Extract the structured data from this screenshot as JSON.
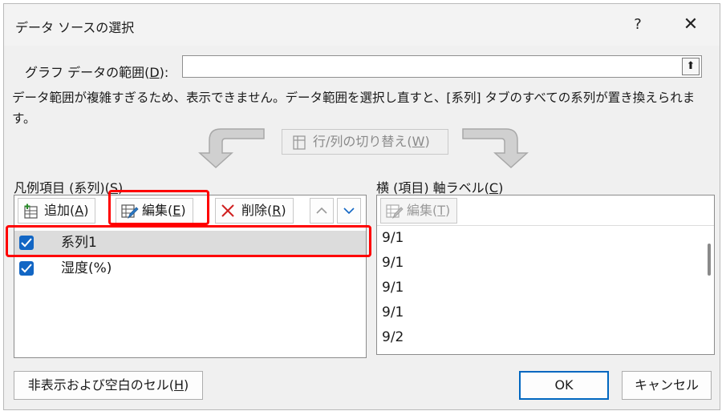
{
  "dialog": {
    "title": "データ ソースの選択",
    "help": "?",
    "close": "✕"
  },
  "range": {
    "label_prefix": "グラフ データの範囲(",
    "label_key": "D",
    "label_suffix": "):",
    "value": "",
    "collapse_icon": "⬆"
  },
  "warning": "データ範囲が複雑すぎるため、表示できません。データ範囲を選択し直すと、[系列] タブのすべての系列が置き換えられます。",
  "switch_button": {
    "prefix": "行/列の切り替え(",
    "key": "W",
    "suffix": ")"
  },
  "legend_section": {
    "label_prefix": "凡例項目 (系列)(",
    "label_key": "S",
    "label_suffix": ")",
    "add": {
      "prefix": "追加(",
      "key": "A",
      "suffix": ")"
    },
    "edit": {
      "prefix": "編集(",
      "key": "E",
      "suffix": ")"
    },
    "remove": {
      "prefix": "削除(",
      "key": "R",
      "suffix": ")"
    },
    "series": [
      {
        "label": "系列1",
        "checked": true
      },
      {
        "label": "湿度(%)",
        "checked": true
      }
    ]
  },
  "axis_section": {
    "label_prefix": "横 (項目) 軸ラベル(",
    "label_key": "C",
    "label_suffix": ")",
    "edit": {
      "prefix": "編集(",
      "key": "T",
      "suffix": ")"
    },
    "items": [
      "9/1",
      "9/1",
      "9/1",
      "9/1",
      "9/2"
    ]
  },
  "buttons": {
    "hidden_cells": {
      "prefix": "非表示および空白のセル(",
      "key": "H",
      "suffix": ")"
    },
    "ok": "OK",
    "cancel": "キャンセル"
  },
  "colors": {
    "accent": "#1266c4",
    "highlight": "#ff0000"
  }
}
